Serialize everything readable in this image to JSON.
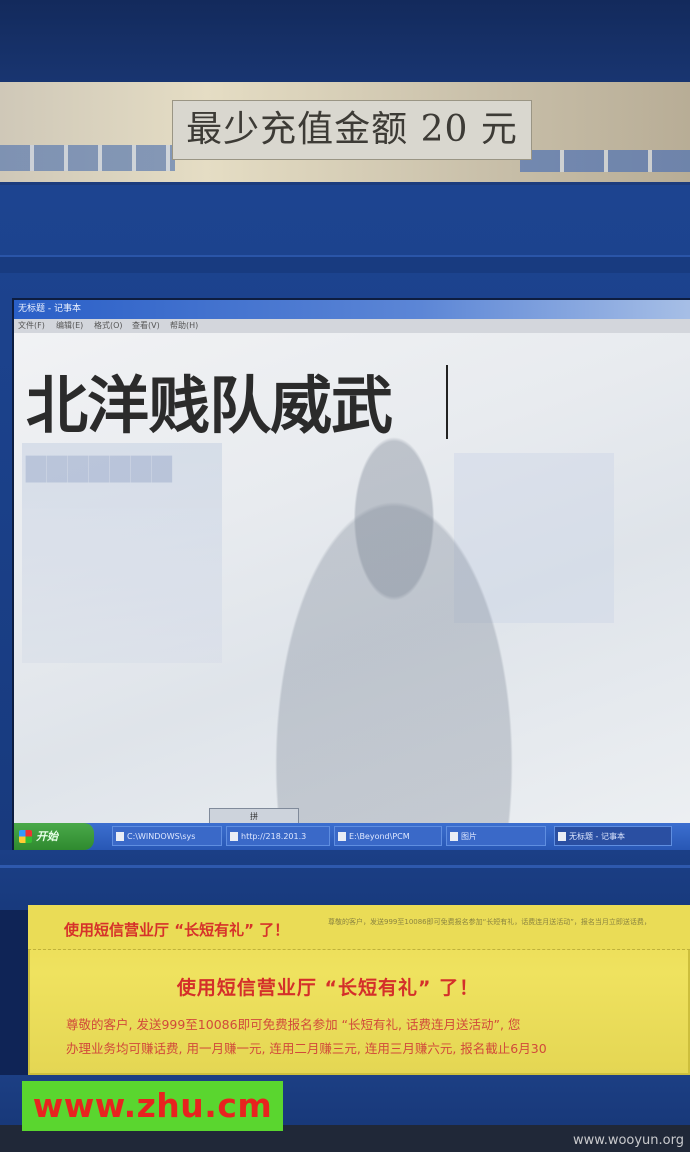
{
  "kiosk": {
    "min_topup_sign": "最少充值金额 20 元"
  },
  "screen": {
    "window_title": "无标题 - 记事本",
    "menu": [
      "文件(F)",
      "编辑(E)",
      "格式(O)",
      "查看(V)",
      "帮助(H)"
    ],
    "typed_text": "北洋贱队威武",
    "ime_bar": "拼",
    "taskbar": {
      "start_label": "开始",
      "tasks": [
        "C:\\WINDOWS\\sys",
        "http://218.201.3",
        "E:\\Beyond\\PCM",
        "图片",
        "无标题 - 记事本"
      ]
    }
  },
  "poster": {
    "small_title": "使用短信营业厅 “长短有礼” 了！",
    "fine_print": "尊敬的客户，发送999至10086即可免费报名参加“长短有礼，话费连月送活动”，报名当月立即送话费，",
    "main_title": "使用短信营业厅 “长短有礼” 了！",
    "body_line1": "尊敬的客户, 发送999至10086即可免费报名参加 “长短有礼, 话费连月送活动”, 您",
    "body_line2": "办理业务均可赚话费, 用一月赚一元, 连用二月赚三元, 连用三月赚六元, 报名截止6月30"
  },
  "watermarks": {
    "zhu": "www.zhu.cm",
    "wooyun": "www.wooyun.org"
  },
  "colors": {
    "kiosk_blue": "#1d4490",
    "poster_yellow": "#efe25f",
    "poster_red": "#d42f2a",
    "watermark_green": "#5ad62f",
    "watermark_red": "#e8231f"
  }
}
